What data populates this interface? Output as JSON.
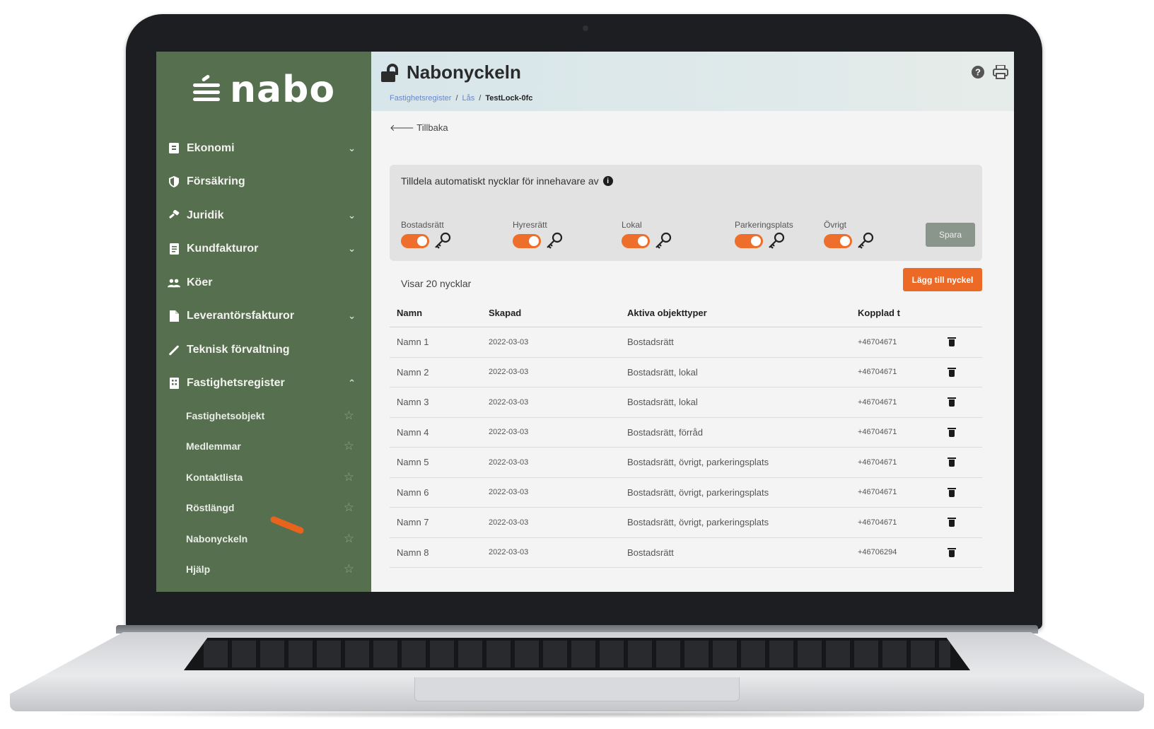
{
  "brand": {
    "logo_text": "nabo"
  },
  "sidebar": {
    "items": [
      {
        "label": "Ekonomi",
        "icon": "ledger-icon",
        "chevron": "⌄"
      },
      {
        "label": "Försäkring",
        "icon": "shield-icon",
        "chevron": ""
      },
      {
        "label": "Juridik",
        "icon": "gavel-icon",
        "chevron": "⌄"
      },
      {
        "label": "Kundfakturor",
        "icon": "invoice-icon",
        "chevron": "⌄"
      },
      {
        "label": "Köer",
        "icon": "people-icon",
        "chevron": ""
      },
      {
        "label": "Leverantörsfakturor",
        "icon": "document-icon",
        "chevron": "⌄"
      },
      {
        "label": "Teknisk förvaltning",
        "icon": "wrench-icon",
        "chevron": ""
      },
      {
        "label": "Fastighetsregister",
        "icon": "building-icon",
        "chevron": "⌃"
      }
    ],
    "subitems": [
      {
        "label": "Fastighetsobjekt"
      },
      {
        "label": "Medlemmar"
      },
      {
        "label": "Kontaktlista"
      },
      {
        "label": "Röstlängd"
      },
      {
        "label": "Nabonyckeln"
      },
      {
        "label": "Hjälp"
      }
    ]
  },
  "header": {
    "title": "Nabonyckeln",
    "breadcrumb": [
      "Fastighetsregister",
      "Lås",
      "TestLock-0fc"
    ]
  },
  "back_label": "Tillbaka",
  "auto_assign": {
    "title": "Tilldela automatiskt nycklar för innehavare av",
    "types": [
      {
        "label": "Bostadsrätt",
        "enabled": true
      },
      {
        "label": "Hyresrätt",
        "enabled": true
      },
      {
        "label": "Lokal",
        "enabled": true
      },
      {
        "label": "Parkeringsplats",
        "enabled": true
      },
      {
        "label": "Övrigt",
        "enabled": true
      }
    ],
    "save_label": "Spara"
  },
  "keys": {
    "count_label": "Visar 20 nycklar",
    "add_label": "Lägg till nyckel",
    "columns": {
      "name": "Namn",
      "created": "Skapad",
      "types": "Aktiva objekttyper",
      "linked": "Kopplad t"
    },
    "rows": [
      {
        "name": "Namn 1",
        "created": "2022-03-03",
        "types": "Bostadsrätt",
        "linked": "+46704671"
      },
      {
        "name": "Namn 2",
        "created": "2022-03-03",
        "types": "Bostadsrätt, lokal",
        "linked": "+46704671"
      },
      {
        "name": "Namn 3",
        "created": "2022-03-03",
        "types": "Bostadsrätt, lokal",
        "linked": "+46704671"
      },
      {
        "name": "Namn 4",
        "created": "2022-03-03",
        "types": "Bostadsrätt, förråd",
        "linked": "+46704671"
      },
      {
        "name": "Namn 5",
        "created": "2022-03-03",
        "types": "Bostadsrätt, övrigt, parkeringsplats",
        "linked": "+46704671"
      },
      {
        "name": "Namn 6",
        "created": "2022-03-03",
        "types": "Bostadsrätt, övrigt, parkeringsplats",
        "linked": "+46704671"
      },
      {
        "name": "Namn 7",
        "created": "2022-03-03",
        "types": "Bostadsrätt, övrigt, parkeringsplats",
        "linked": "+46704671"
      },
      {
        "name": "Namn 8",
        "created": "2022-03-03",
        "types": "Bostadsrätt",
        "linked": "+46706294"
      }
    ]
  },
  "colors": {
    "sidebar": "#56704f",
    "accent": "#ec6a25",
    "save_button": "#8a958b"
  }
}
